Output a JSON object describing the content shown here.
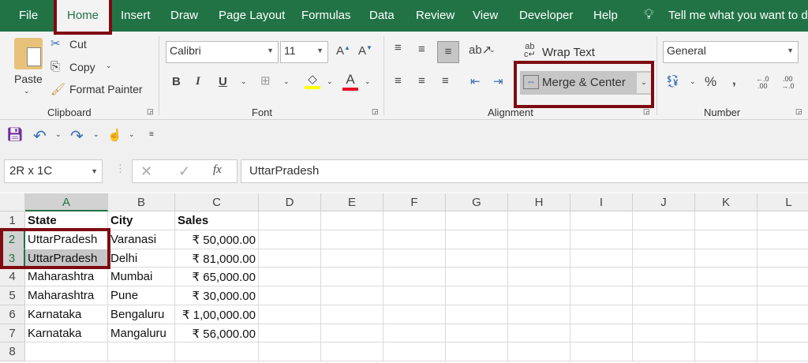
{
  "menu": {
    "tabs": [
      "File",
      "Home",
      "Insert",
      "Draw",
      "Page Layout",
      "Formulas",
      "Data",
      "Review",
      "View",
      "Developer",
      "Help"
    ],
    "tell_me": "Tell me what you want to do"
  },
  "ribbon": {
    "clipboard": {
      "paste": "Paste",
      "cut": "Cut",
      "copy": "Copy",
      "format_painter": "Format Painter",
      "group": "Clipboard"
    },
    "font": {
      "name": "Calibri",
      "size": "11",
      "bold": "B",
      "italic": "I",
      "underline": "U",
      "group": "Font",
      "fill_color": "#ffff00",
      "font_color": "#e81123"
    },
    "alignment": {
      "wrap_text": "Wrap Text",
      "merge_center": "Merge & Center",
      "group": "Alignment"
    },
    "number": {
      "format": "General",
      "percent": "%",
      "comma": ",",
      "group": "Number"
    }
  },
  "formula_bar": {
    "name_box": "2R x 1C",
    "fx": "fx",
    "value": "UttarPradesh"
  },
  "sheet": {
    "columns": [
      "A",
      "B",
      "C",
      "D",
      "E",
      "F",
      "G",
      "H",
      "I",
      "J",
      "K",
      "L"
    ],
    "rows": [
      "1",
      "2",
      "3",
      "4",
      "5",
      "6",
      "7",
      "8"
    ],
    "cells": [
      [
        "State",
        "City",
        "Sales"
      ],
      [
        "UttarPradesh",
        "Varanasi",
        "₹ 50,000.00"
      ],
      [
        "UttarPradesh",
        "Delhi",
        "₹ 81,000.00"
      ],
      [
        "Maharashtra",
        "Mumbai",
        "₹ 65,000.00"
      ],
      [
        "Maharashtra",
        "Pune",
        "₹ 30,000.00"
      ],
      [
        "Karnataka",
        "Bengaluru",
        "₹ 1,00,000.00"
      ],
      [
        "Karnataka",
        "Mangaluru",
        "₹ 56,000.00"
      ],
      [
        "",
        "",
        ""
      ]
    ]
  },
  "colors": {
    "brand": "#217346",
    "highlight": "#7f0a12"
  }
}
